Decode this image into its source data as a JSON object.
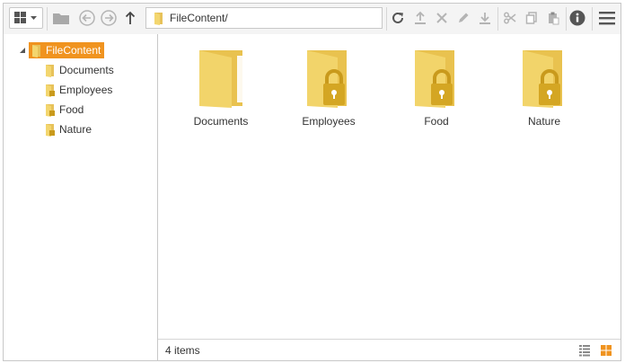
{
  "toolbar": {
    "view_icon": "grid-view-icon",
    "address_path": "FileContent/",
    "accent_color": "#f0931f"
  },
  "tree": {
    "root": "FileContent",
    "children": [
      "Documents",
      "Employees",
      "Food",
      "Nature"
    ]
  },
  "main": {
    "items": [
      {
        "name": "Documents",
        "locked": false
      },
      {
        "name": "Employees",
        "locked": true
      },
      {
        "name": "Food",
        "locked": true
      },
      {
        "name": "Nature",
        "locked": true
      }
    ]
  },
  "status": {
    "count_text": "4 items"
  }
}
